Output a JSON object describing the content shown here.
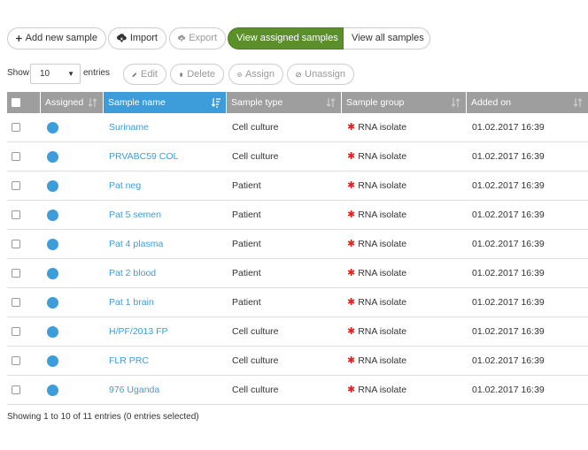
{
  "toolbar": {
    "add_label": "Add new sample",
    "import_label": "Import",
    "export_label": "Export",
    "view_assigned_label": "View assigned samples",
    "view_all_label": "View all samples"
  },
  "length": {
    "show_label": "Show",
    "value": "10",
    "entries_label": "entries"
  },
  "actions": {
    "edit_label": "Edit",
    "delete_label": "Delete",
    "assign_label": "Assign",
    "unassign_label": "Unassign"
  },
  "table": {
    "columns": [
      "Assigned",
      "Sample name",
      "Sample type",
      "Sample group",
      "Added on"
    ],
    "rows": [
      {
        "name": "Suriname",
        "type": "Cell culture",
        "group": "RNA isolate",
        "added": "01.02.2017 16:39"
      },
      {
        "name": "PRVABC59 COL",
        "type": "Cell culture",
        "group": "RNA isolate",
        "added": "01.02.2017 16:39"
      },
      {
        "name": "Pat neg",
        "type": "Patient",
        "group": "RNA isolate",
        "added": "01.02.2017 16:39"
      },
      {
        "name": "Pat 5 semen",
        "type": "Patient",
        "group": "RNA isolate",
        "added": "01.02.2017 16:39"
      },
      {
        "name": "Pat 4 plasma",
        "type": "Patient",
        "group": "RNA isolate",
        "added": "01.02.2017 16:39"
      },
      {
        "name": "Pat 2 blood",
        "type": "Patient",
        "group": "RNA isolate",
        "added": "01.02.2017 16:39"
      },
      {
        "name": "Pat 1 brain",
        "type": "Patient",
        "group": "RNA isolate",
        "added": "01.02.2017 16:39"
      },
      {
        "name": "H/PF/2013 FP",
        "type": "Cell culture",
        "group": "RNA isolate",
        "added": "01.02.2017 16:39"
      },
      {
        "name": "FLR PRC",
        "type": "Cell culture",
        "group": "RNA isolate",
        "added": "01.02.2017 16:39"
      },
      {
        "name": "976 Uganda",
        "type": "Cell culture",
        "group": "RNA isolate",
        "added": "01.02.2017 16:39"
      }
    ]
  },
  "footer": {
    "info": "Showing 1 to 10 of 11 entries (0 entries selected)"
  },
  "colors": {
    "accent": "#3d9ddb",
    "green": "#5a8f29",
    "header_gray": "#9e9e9e",
    "group_marker": "#e32020"
  }
}
